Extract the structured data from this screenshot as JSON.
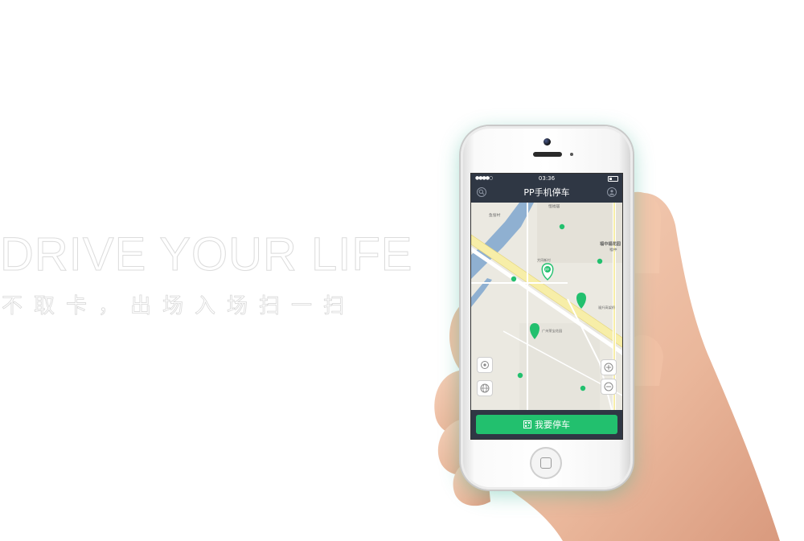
{
  "hero": {
    "title": "DRIVE YOUR LIFE",
    "subtitle": "不取卡，出场入场扫一扫"
  },
  "phone": {
    "status_bar": {
      "time": "03:36",
      "signal": "●●●●○"
    },
    "nav": {
      "title": "PP手机停车",
      "left_icon": "search-icon",
      "right_icon": "user-icon"
    },
    "map": {
      "labels": [
        "恒福居",
        "鱼窑村",
        "福中福花园",
        "福中",
        "大同新村",
        "福升高架桥",
        "广州莱宝花园"
      ],
      "controls": [
        "locate-icon",
        "globe-icon",
        "zoom-in-icon",
        "zoom-out-icon"
      ],
      "accent": "#22c06e"
    },
    "bottom": {
      "park_button_label": "我要停车",
      "park_button_icon": "qr-code-icon"
    }
  },
  "colors": {
    "bar_dark": "#2f3744",
    "brand_green": "#22c06e",
    "water": "#8fb0d1",
    "road": "#f7eea8"
  }
}
